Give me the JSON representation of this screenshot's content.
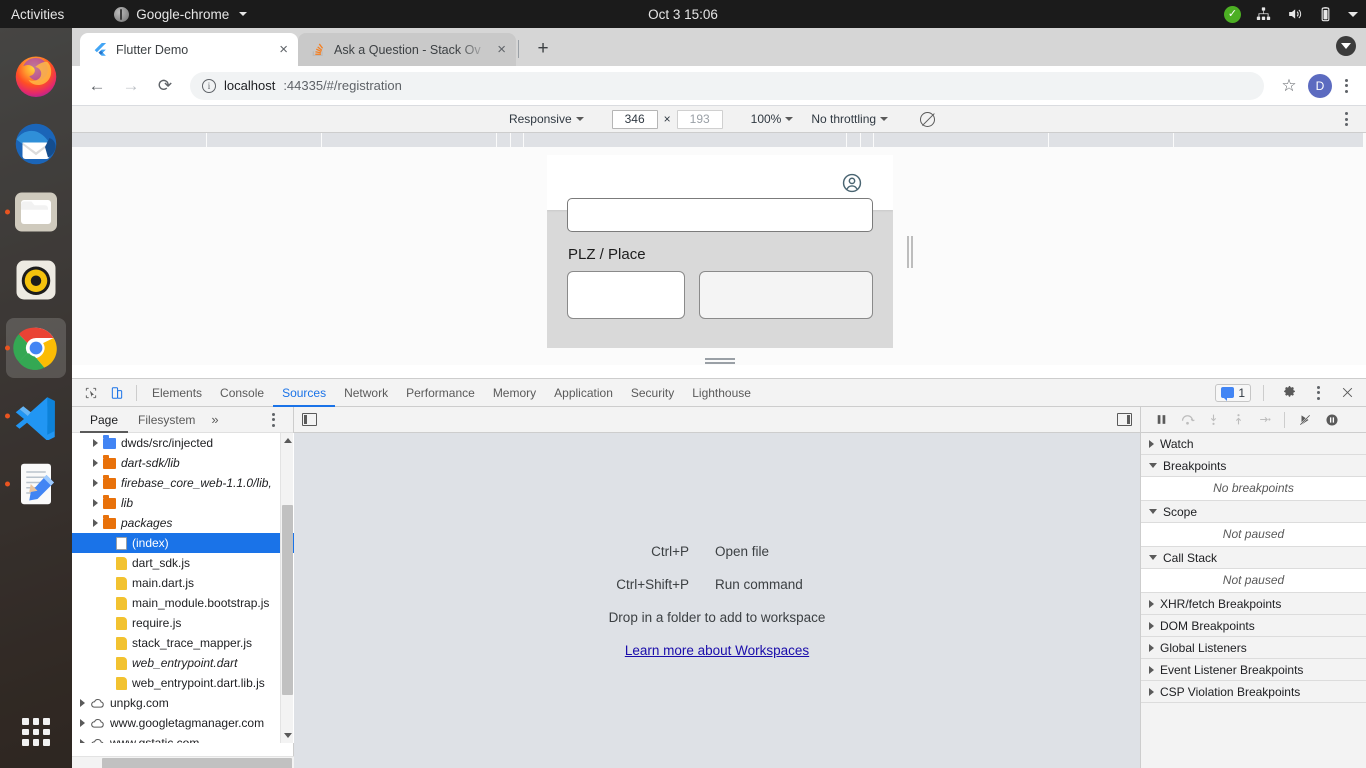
{
  "topbar": {
    "activities": "Activities",
    "app_menu": "Google-chrome",
    "clock": "Oct 3  15:06"
  },
  "dock": {
    "items": [
      {
        "name": "firefox",
        "running": false
      },
      {
        "name": "thunderbird",
        "running": false
      },
      {
        "name": "files",
        "running": true
      },
      {
        "name": "rhythmbox",
        "running": false
      },
      {
        "name": "google-chrome",
        "running": true,
        "active": true
      },
      {
        "name": "vscode",
        "running": true
      },
      {
        "name": "text-editor",
        "running": true
      }
    ],
    "show_apps": "Show Applications"
  },
  "browser": {
    "tabs": [
      {
        "title": "Flutter Demo",
        "favicon": "flutter",
        "active": true,
        "close": "×"
      },
      {
        "title": "Ask a Question - Stack Ov",
        "favicon": "stackoverflow",
        "active": false,
        "close": "×"
      }
    ],
    "new_tab": "+",
    "back": "←",
    "forward": "→",
    "reload": "⟳",
    "url_host": "localhost",
    "url_rest": ":44335/#/registration",
    "info_glyph": "i",
    "bookmark_star": "☆",
    "avatar_letter": "D"
  },
  "device_toolbar": {
    "device": "Responsive",
    "width": "346",
    "height": "193",
    "zoom": "100%",
    "throttling": "No throttling",
    "no_image_title": "Disable image"
  },
  "app": {
    "person_icon": "account-circle-icon",
    "label": "PLZ / Place"
  },
  "devtools": {
    "tabs": [
      {
        "label": "Elements",
        "selected": false
      },
      {
        "label": "Console",
        "selected": false
      },
      {
        "label": "Sources",
        "selected": true
      },
      {
        "label": "Network",
        "selected": false
      },
      {
        "label": "Performance",
        "selected": false
      },
      {
        "label": "Memory",
        "selected": false
      },
      {
        "label": "Application",
        "selected": false
      },
      {
        "label": "Security",
        "selected": false
      },
      {
        "label": "Lighthouse",
        "selected": false
      }
    ],
    "message_count": "1",
    "nav_tabs": [
      {
        "label": "Page",
        "selected": true
      },
      {
        "label": "Filesystem",
        "selected": false
      }
    ],
    "nav_more": "»",
    "tree": [
      {
        "label": "dwds/src/injected",
        "type": "folder-blue",
        "indent": 1,
        "arrow": true,
        "italic": false
      },
      {
        "label": "dart-sdk/lib",
        "type": "folder-orange",
        "indent": 1,
        "arrow": true,
        "italic": true
      },
      {
        "label": "firebase_core_web-1.1.0/lib,",
        "type": "folder-orange",
        "indent": 1,
        "arrow": true,
        "italic": true
      },
      {
        "label": "lib",
        "type": "folder-orange",
        "indent": 1,
        "arrow": true,
        "italic": true
      },
      {
        "label": "packages",
        "type": "folder-orange",
        "indent": 1,
        "arrow": true,
        "italic": true
      },
      {
        "label": "(index)",
        "type": "doc",
        "indent": 2,
        "arrow": false,
        "italic": false,
        "selected": true
      },
      {
        "label": "dart_sdk.js",
        "type": "js",
        "indent": 2,
        "arrow": false,
        "italic": false
      },
      {
        "label": "main.dart.js",
        "type": "js",
        "indent": 2,
        "arrow": false,
        "italic": false
      },
      {
        "label": "main_module.bootstrap.js",
        "type": "js",
        "indent": 2,
        "arrow": false,
        "italic": false
      },
      {
        "label": "require.js",
        "type": "js",
        "indent": 2,
        "arrow": false,
        "italic": false
      },
      {
        "label": "stack_trace_mapper.js",
        "type": "js",
        "indent": 2,
        "arrow": false,
        "italic": false
      },
      {
        "label": "web_entrypoint.dart",
        "type": "js",
        "indent": 2,
        "arrow": false,
        "italic": true
      },
      {
        "label": "web_entrypoint.dart.lib.js",
        "type": "js",
        "indent": 2,
        "arrow": false,
        "italic": false
      },
      {
        "label": "unpkg.com",
        "type": "cloud",
        "indent": 0,
        "arrow": true,
        "italic": false
      },
      {
        "label": "www.googletagmanager.com",
        "type": "cloud",
        "indent": 0,
        "arrow": true,
        "italic": false
      },
      {
        "label": "www.gstatic.com",
        "type": "cloud",
        "indent": 0,
        "arrow": true,
        "italic": false
      }
    ],
    "editor_empty": {
      "rows": [
        {
          "key": "Ctrl+P",
          "desc": "Open file"
        },
        {
          "key": "Ctrl+Shift+P",
          "desc": "Run command"
        }
      ],
      "drop_hint": "Drop in a folder to add to workspace",
      "link": "Learn more about Workspaces"
    },
    "debugger": {
      "controls": [
        {
          "name": "pause-script-execution",
          "glyph": "⏸",
          "dim": false
        },
        {
          "name": "step-over-next-function-call",
          "glyph": "⤵",
          "dim": true
        },
        {
          "name": "step-into-next-function-call",
          "glyph": "↓",
          "dim": true
        },
        {
          "name": "step-out-of-current-function",
          "glyph": "↑",
          "dim": true
        },
        {
          "name": "step",
          "glyph": "→",
          "dim": true
        },
        {
          "name": "deactivate-breakpoints",
          "glyph": "▶",
          "dim": false
        },
        {
          "name": "pause-on-exceptions",
          "glyph": "⏸",
          "dim": false
        }
      ],
      "sections": [
        {
          "label": "Watch",
          "expanded": false,
          "body": null
        },
        {
          "label": "Breakpoints",
          "expanded": true,
          "body": "No breakpoints"
        },
        {
          "label": "Scope",
          "expanded": true,
          "body": "Not paused"
        },
        {
          "label": "Call Stack",
          "expanded": true,
          "body": "Not paused"
        },
        {
          "label": "XHR/fetch Breakpoints",
          "expanded": false,
          "body": null
        },
        {
          "label": "DOM Breakpoints",
          "expanded": false,
          "body": null
        },
        {
          "label": "Global Listeners",
          "expanded": false,
          "body": null
        },
        {
          "label": "Event Listener Breakpoints",
          "expanded": false,
          "body": null
        },
        {
          "label": "CSP Violation Breakpoints",
          "expanded": false,
          "body": null
        }
      ]
    }
  },
  "colors": {
    "accent_blue": "#1a73e8",
    "folder_orange": "#e8710a",
    "folder_blue": "#4285f4",
    "js_yellow": "#f2c230",
    "ubuntu_orange": "#e95420",
    "link": "#1a0dab"
  }
}
